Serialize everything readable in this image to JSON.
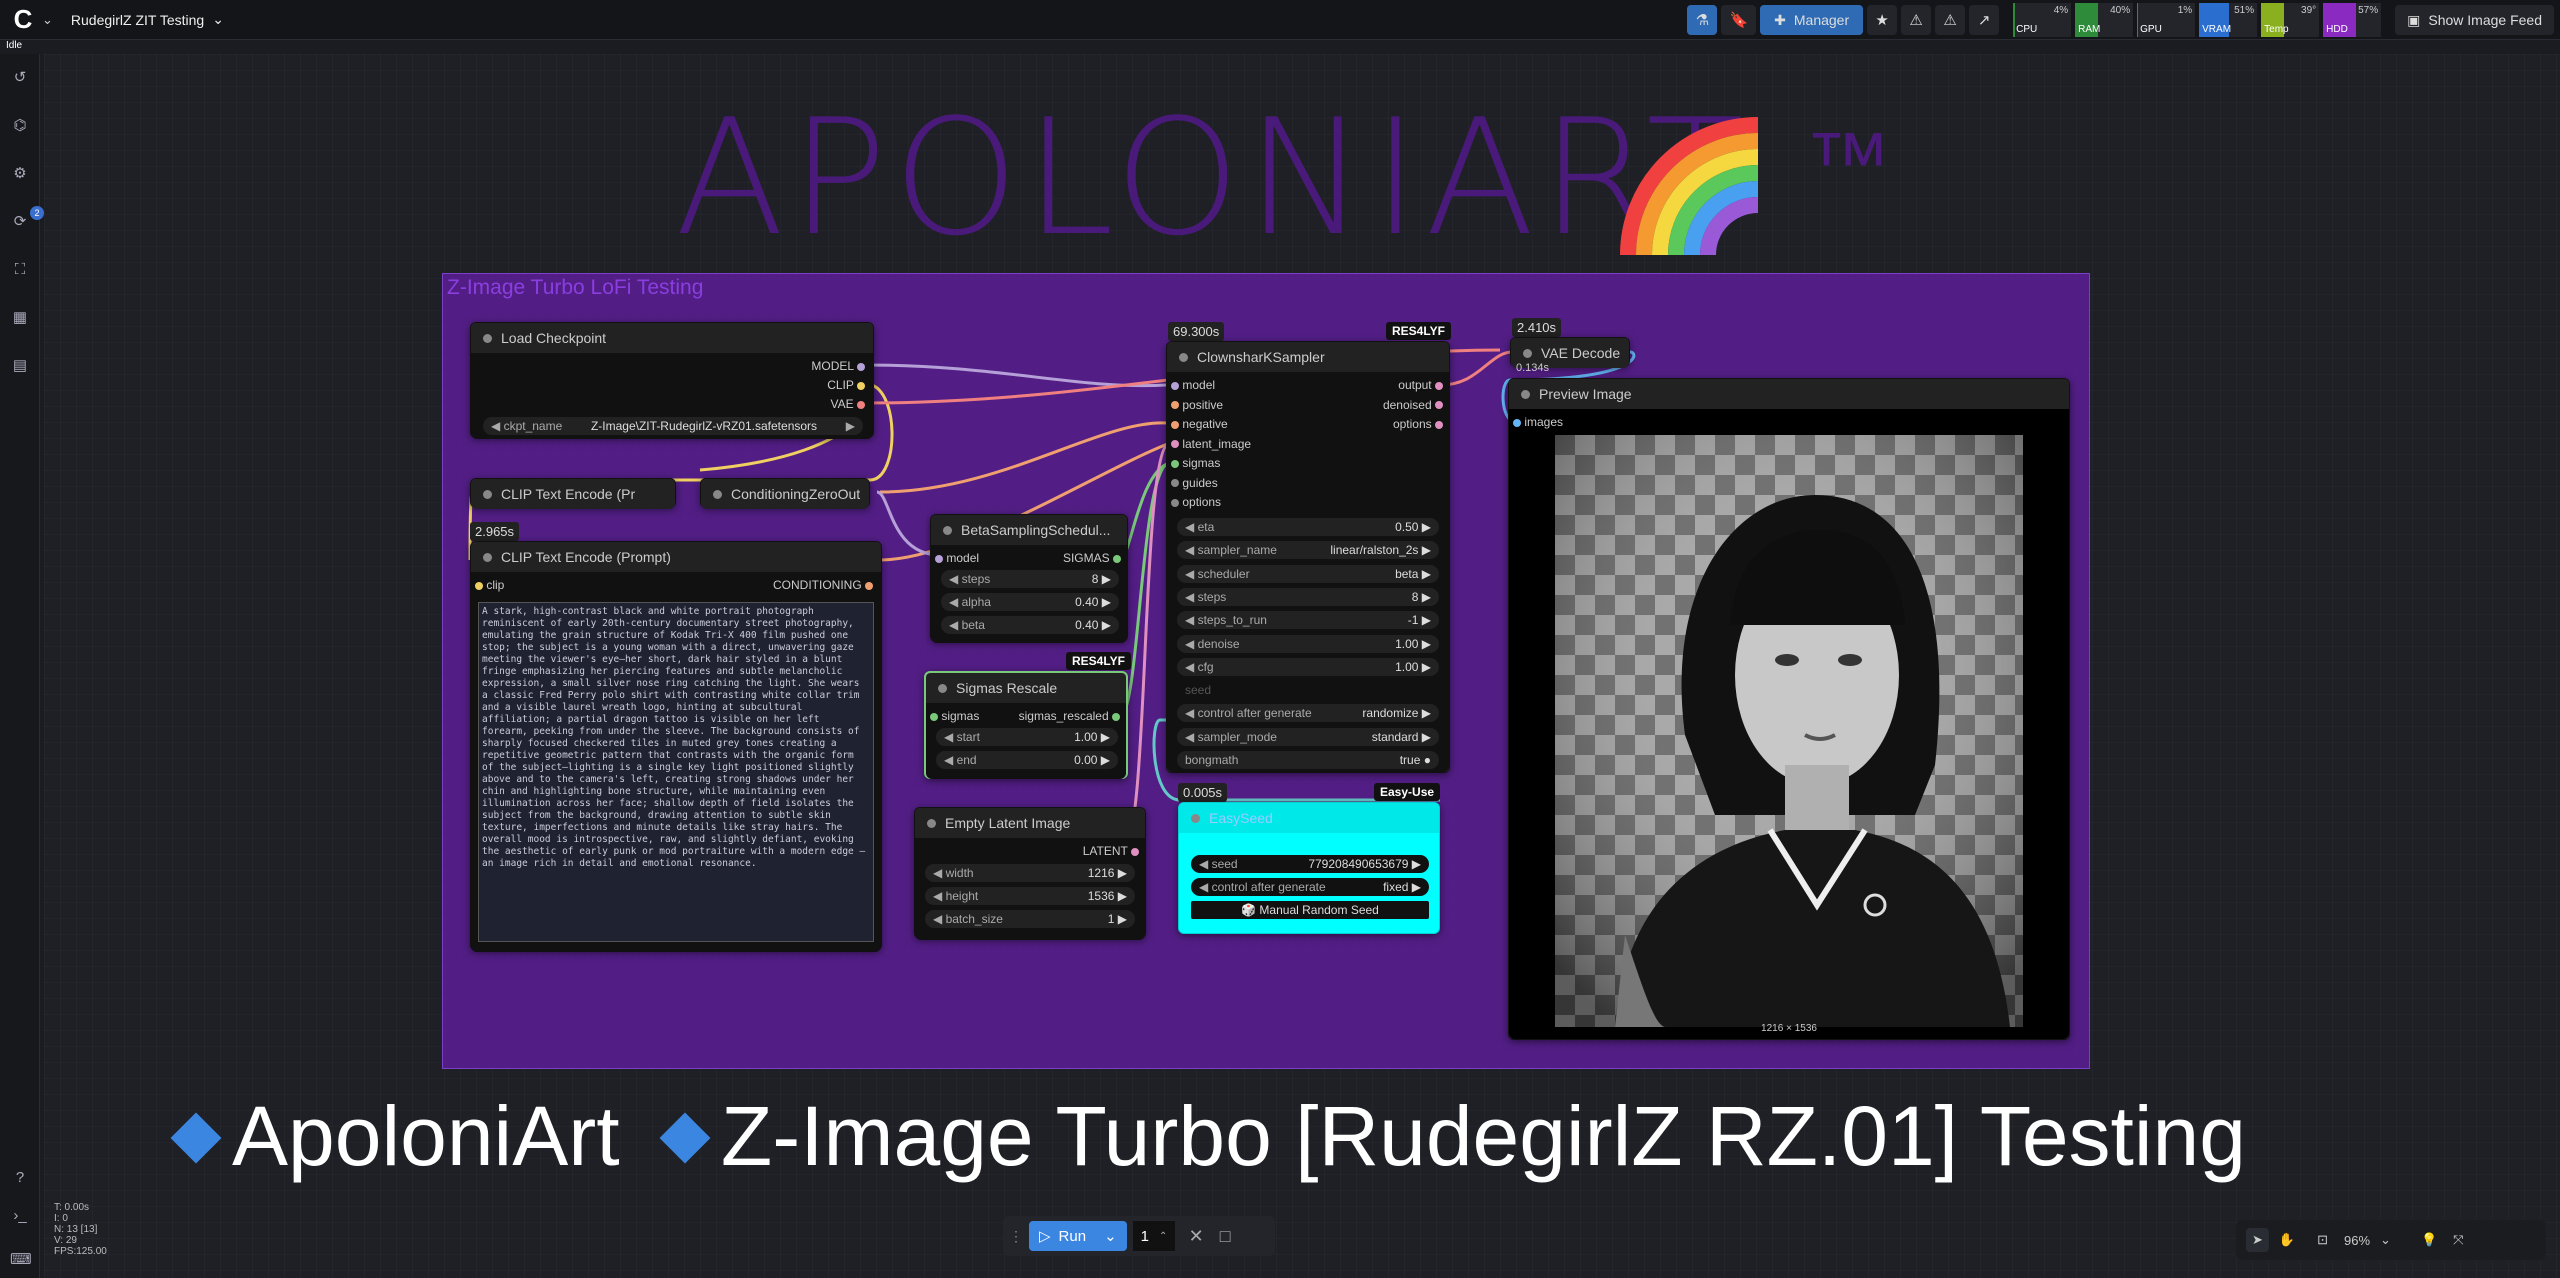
{
  "topbar": {
    "workflow_name": "RudegirlZ ZIT Testing",
    "manager": "Manager",
    "show_feed": "Show Image Feed",
    "meters": [
      {
        "label": "CPU",
        "value": "4%",
        "pct": 4,
        "color": "#2e8b3a"
      },
      {
        "label": "RAM",
        "value": "40%",
        "pct": 40,
        "color": "#2e8b3a"
      },
      {
        "label": "GPU",
        "value": "1%",
        "pct": 1,
        "color": "#2e8b3a"
      },
      {
        "label": "VRAM",
        "value": "51%",
        "pct": 51,
        "color": "#2a6fd0"
      },
      {
        "label": "Temp",
        "value": "39°",
        "pct": 39,
        "color": "#8ab020"
      },
      {
        "label": "HDD",
        "value": "57%",
        "pct": 57,
        "color": "#8a2ac0"
      }
    ]
  },
  "status": "Idle",
  "sidebar": {
    "queue_badge": "2"
  },
  "title": "APOLONIART",
  "tm": "™",
  "group_title": "Z-Image Turbo LoFi Testing",
  "nodes": {
    "load_checkpoint": {
      "title": "Load Checkpoint",
      "outputs": [
        "MODEL",
        "CLIP",
        "VAE"
      ],
      "ckpt_label": "ckpt_name",
      "ckpt_value": "Z-Image\\ZIT-RudegirlZ-vRZ01.safetensors"
    },
    "clip_small": {
      "title": "CLIP Text Encode (Pr"
    },
    "cond_zero": {
      "title": "ConditioningZeroOut"
    },
    "clip_prompt": {
      "time": "2.965s",
      "title": "CLIP Text Encode (Prompt)",
      "input": "clip",
      "output": "CONDITIONING",
      "text": "A stark, high-contrast black and white portrait photograph reminiscent of early 20th-century documentary street photography, emulating the grain structure of Kodak Tri-X 400 film pushed one stop; the subject is a young woman with a direct, unwavering gaze meeting the viewer's eye—her short, dark hair styled in a blunt fringe emphasizing her piercing features and subtle melancholic expression, a small silver nose ring catching the light. She wears a classic Fred Perry polo shirt with contrasting white collar trim and a visible laurel wreath logo, hinting at subcultural affiliation; a partial dragon tattoo is visible on her left forearm, peeking from under the sleeve. The background consists of sharply focused checkered tiles in muted grey tones creating a repetitive geometric pattern that contrasts with the organic form of the subject—lighting is a single key light positioned slightly above and to the camera's left, creating strong shadows under her chin and highlighting bone structure, while maintaining even illumination across her face; shallow depth of field isolates the subject from the background, drawing attention to subtle skin texture, imperfections and minute details like stray hairs. The overall mood is introspective, raw, and slightly defiant, evoking the aesthetic of early punk or mod portraiture with a modern edge — an image rich in detail and emotional resonance."
    },
    "beta": {
      "title": "BetaSamplingSchedul...",
      "input": "model",
      "output": "SIGMAS",
      "widgets": [
        {
          "label": "steps",
          "value": "8"
        },
        {
          "label": "alpha",
          "value": "0.40"
        },
        {
          "label": "beta",
          "value": "0.40"
        }
      ]
    },
    "sigmas_rescale": {
      "tag": "RES4LYF",
      "title": "Sigmas Rescale",
      "input": "sigmas",
      "output": "sigmas_rescaled",
      "widgets": [
        {
          "label": "start",
          "value": "1.00"
        },
        {
          "label": "end",
          "value": "0.00"
        }
      ]
    },
    "empty_latent": {
      "title": "Empty Latent Image",
      "output": "LATENT",
      "widgets": [
        {
          "label": "width",
          "value": "1216"
        },
        {
          "label": "height",
          "value": "1536"
        },
        {
          "label": "batch_size",
          "value": "1"
        }
      ]
    },
    "sampler": {
      "time": "69.300s",
      "tag": "RES4LYF",
      "title": "ClownsharKSampler",
      "inputs": [
        "model",
        "positive",
        "negative",
        "latent_image",
        "sigmas",
        "guides",
        "options"
      ],
      "outputs": [
        "output",
        "denoised",
        "options"
      ],
      "widgets": [
        {
          "label": "eta",
          "value": "0.50"
        },
        {
          "label": "sampler_name",
          "value": "linear/ralston_2s"
        },
        {
          "label": "scheduler",
          "value": "beta"
        },
        {
          "label": "steps",
          "value": "8"
        },
        {
          "label": "steps_to_run",
          "value": "-1"
        },
        {
          "label": "denoise",
          "value": "1.00"
        },
        {
          "label": "cfg",
          "value": "1.00"
        },
        {
          "label": "seed",
          "value": ""
        },
        {
          "label": "control after generate",
          "value": "randomize"
        },
        {
          "label": "sampler_mode",
          "value": "standard"
        },
        {
          "label": "bongmath",
          "value": "true"
        }
      ]
    },
    "easy_seed": {
      "time": "0.005s",
      "tag": "Easy-Use",
      "title": "EasySeed",
      "widgets": [
        {
          "label": "seed",
          "value": "779208490653679"
        },
        {
          "label": "control after generate",
          "value": "fixed"
        }
      ],
      "button": "🎲 Manual Random Seed"
    },
    "vae_decode": {
      "time": "2.410s",
      "time2": "0.134s",
      "title": "VAE Decode"
    },
    "preview": {
      "title": "Preview Image",
      "input": "images",
      "size": "1216 × 1536"
    }
  },
  "subtitle": {
    "part1": "ApoloniArt",
    "part2": "Z-Image Turbo [RudegirlZ RZ.01] Testing"
  },
  "runbar": {
    "run": "Run",
    "qty": "1"
  },
  "stats": [
    "T: 0.00s",
    "I: 0",
    "N: 13 [13]",
    "V: 29",
    "FPS:125.00"
  ],
  "zoom": "96%"
}
